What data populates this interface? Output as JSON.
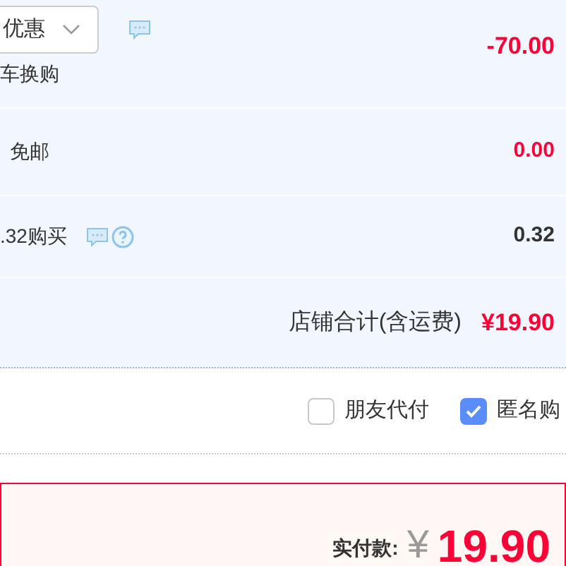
{
  "rows": [
    {
      "kind": "promo",
      "dropdown": "优惠",
      "note": "车换购",
      "amount": "-70.00"
    },
    {
      "kind": "shipping",
      "label": "免邮",
      "amount": "0.00"
    },
    {
      "kind": "extra",
      "label": ".32购买",
      "amount": "0.32"
    },
    {
      "kind": "total",
      "label": "店铺合计(含运费)",
      "amount": "¥19.90"
    }
  ],
  "options": [
    {
      "label": "朋友代付",
      "checked": false
    },
    {
      "label": "匿名购",
      "checked": true
    }
  ],
  "payment": {
    "label": "实付款:",
    "currency": "¥",
    "amount": "19.90"
  }
}
